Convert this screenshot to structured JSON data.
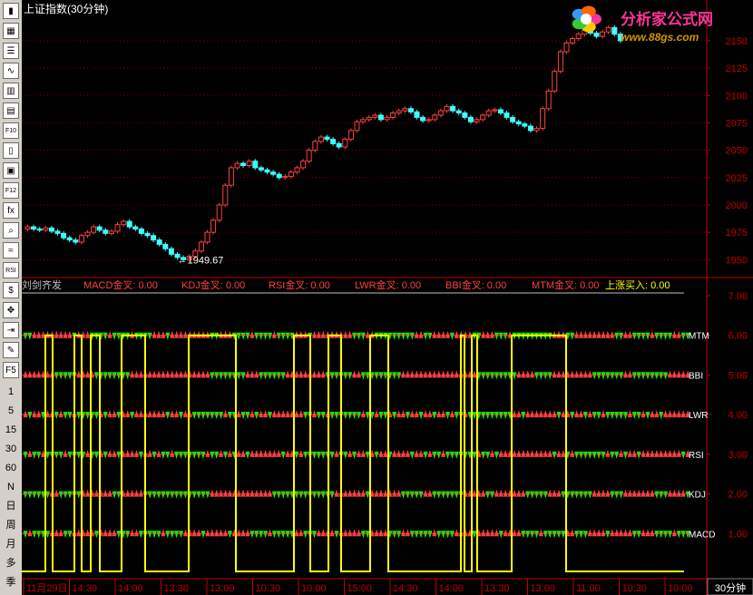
{
  "window": {
    "title": "上证指数(30分钟)"
  },
  "logo": {
    "text": "分析家公式网",
    "url": "www.88gs.com"
  },
  "colors": {
    "up": "#ff4040",
    "down": "#40ffff",
    "grid": "#800000",
    "axis": "#c00000",
    "yellow": "#ffff00",
    "green": "#00ff00"
  },
  "toolbar": {
    "icons": [
      {
        "name": "candlestick-chart-icon",
        "glyph": "▮"
      },
      {
        "name": "table-report-icon",
        "glyph": "▦"
      },
      {
        "name": "minute-chart-icon",
        "glyph": "☰"
      },
      {
        "name": "line-trend-icon",
        "glyph": "∿"
      },
      {
        "name": "bar-chart-icon",
        "glyph": "▥"
      },
      {
        "name": "window-list-icon",
        "glyph": "▤"
      },
      {
        "name": "f10-info-icon",
        "glyph": "F10"
      },
      {
        "name": "document-icon",
        "glyph": "▯"
      },
      {
        "name": "finance-book-icon",
        "glyph": "▣"
      },
      {
        "name": "f12-icon",
        "glyph": "F12"
      },
      {
        "name": "formula-icon",
        "glyph": "fx"
      },
      {
        "name": "search-icon",
        "glyph": "⌕"
      },
      {
        "name": "indicator-wave-icon",
        "glyph": "≈"
      },
      {
        "name": "rsi-icon",
        "glyph": "RSI"
      },
      {
        "name": "dollar-icon",
        "glyph": "$"
      },
      {
        "name": "move-arrows-icon",
        "glyph": "✥"
      },
      {
        "name": "import-icon",
        "glyph": "⇥"
      },
      {
        "name": "pencil-draw-icon",
        "glyph": "✎"
      },
      {
        "name": "f5-switch-icon",
        "glyph": "F5"
      }
    ],
    "periods": [
      "1",
      "5",
      "15",
      "30",
      "60",
      "N",
      "日",
      "周",
      "月",
      "多",
      "季"
    ]
  },
  "main_chart": {
    "annotation": "←1949.67",
    "y_ticks": [
      "2150",
      "2125",
      "2100",
      "2075",
      "2050",
      "2025",
      "2000",
      "1975",
      "1950"
    ]
  },
  "sub_chart": {
    "indicator_name": "刘剑齐发",
    "legend": [
      {
        "label": "MACD金叉:",
        "value": "0.00"
      },
      {
        "label": "KDJ金叉:",
        "value": "0.00"
      },
      {
        "label": "RSI金叉:",
        "value": "0.00"
      },
      {
        "label": "LWR金叉:",
        "value": "0.00"
      },
      {
        "label": "BBI金叉:",
        "value": "0.00"
      },
      {
        "label": "MTM金叉:",
        "value": "0.00"
      },
      {
        "label": "上涨买入:",
        "value": "0.00"
      }
    ],
    "y_ticks": [
      "7.00",
      "6.00",
      "5.00",
      "4.00",
      "3.00",
      "2.00",
      "1.00"
    ],
    "row_labels": [
      "MTM",
      "BBI",
      "LWR",
      "RSI",
      "KDJ",
      "MACD"
    ]
  },
  "time_axis": {
    "labels": [
      "11月29日",
      "14:30",
      "14:00",
      "13:30",
      "13:00",
      "10:30",
      "10:00",
      "15:00",
      "14:30",
      "14:00",
      "13:30",
      "13:00",
      "11:00",
      "10:30",
      "10:00"
    ],
    "period_label": "30分钟"
  },
  "chart_data": {
    "type": "candlestick",
    "title": "上证指数(30分钟)",
    "ylim": [
      1937,
      2164
    ],
    "low_marker": 1949.67,
    "closes": [
      1980,
      1978,
      1977,
      1979,
      1976,
      1974,
      1970,
      1968,
      1966,
      1972,
      1975,
      1980,
      1977,
      1974,
      1976,
      1982,
      1985,
      1980,
      1978,
      1974,
      1972,
      1968,
      1964,
      1960,
      1955,
      1952,
      1950,
      1953,
      1958,
      1966,
      1975,
      1986,
      2000,
      2018,
      2034,
      2038,
      2036,
      2040,
      2034,
      2032,
      2030,
      2028,
      2025,
      2026,
      2030,
      2034,
      2040,
      2050,
      2058,
      2062,
      2060,
      2056,
      2053,
      2060,
      2068,
      2076,
      2078,
      2080,
      2082,
      2078,
      2080,
      2084,
      2086,
      2088,
      2085,
      2080,
      2077,
      2078,
      2082,
      2086,
      2090,
      2086,
      2084,
      2080,
      2076,
      2078,
      2082,
      2086,
      2087,
      2084,
      2080,
      2076,
      2074,
      2072,
      2068,
      2070,
      2088,
      2104,
      2122,
      2140,
      2148,
      2152,
      2156,
      2160,
      2157,
      2154,
      2158,
      2162,
      2156,
      2150
    ]
  }
}
